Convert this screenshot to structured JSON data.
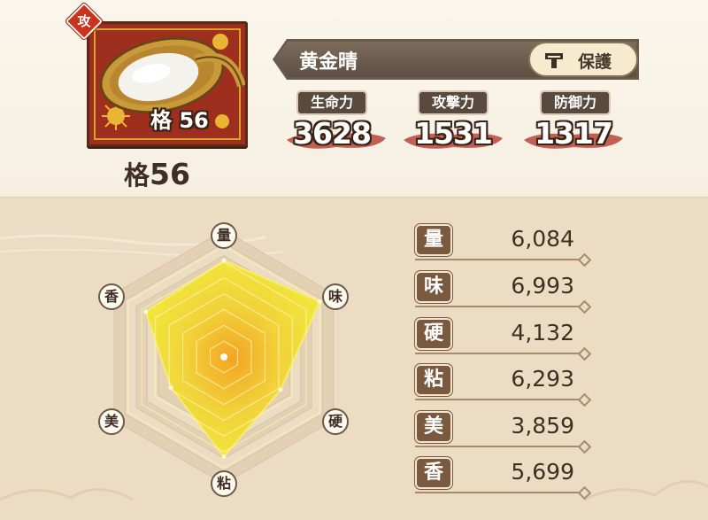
{
  "item": {
    "name": "黄金晴",
    "grade": "格 56",
    "grade_label": "格",
    "grade_value": "56",
    "attack_badge": "攻",
    "image": "rice-basket"
  },
  "protect_button": {
    "label": "保護",
    "icon": "lock-icon"
  },
  "stats": [
    {
      "label": "生命力",
      "value": "3628"
    },
    {
      "label": "攻撃力",
      "value": "1531"
    },
    {
      "label": "防御力",
      "value": "1317"
    }
  ],
  "chart_data": {
    "type": "radar",
    "axes": [
      "量",
      "味",
      "硬",
      "粘",
      "美",
      "香"
    ],
    "values": [
      6084,
      6993,
      4132,
      6293,
      3859,
      5699
    ],
    "max": 8000,
    "fill_color": "#f2e634"
  },
  "attributes": [
    {
      "label": "量",
      "value": "6,084"
    },
    {
      "label": "味",
      "value": "6,993"
    },
    {
      "label": "硬",
      "value": "4,132"
    },
    {
      "label": "粘",
      "value": "6,293"
    },
    {
      "label": "美",
      "value": "3,859"
    },
    {
      "label": "香",
      "value": "5,699"
    }
  ],
  "colors": {
    "accent_red": "#c9321f",
    "panel_brown": "#5a4a3e",
    "radar_yellow": "#f2e634"
  }
}
